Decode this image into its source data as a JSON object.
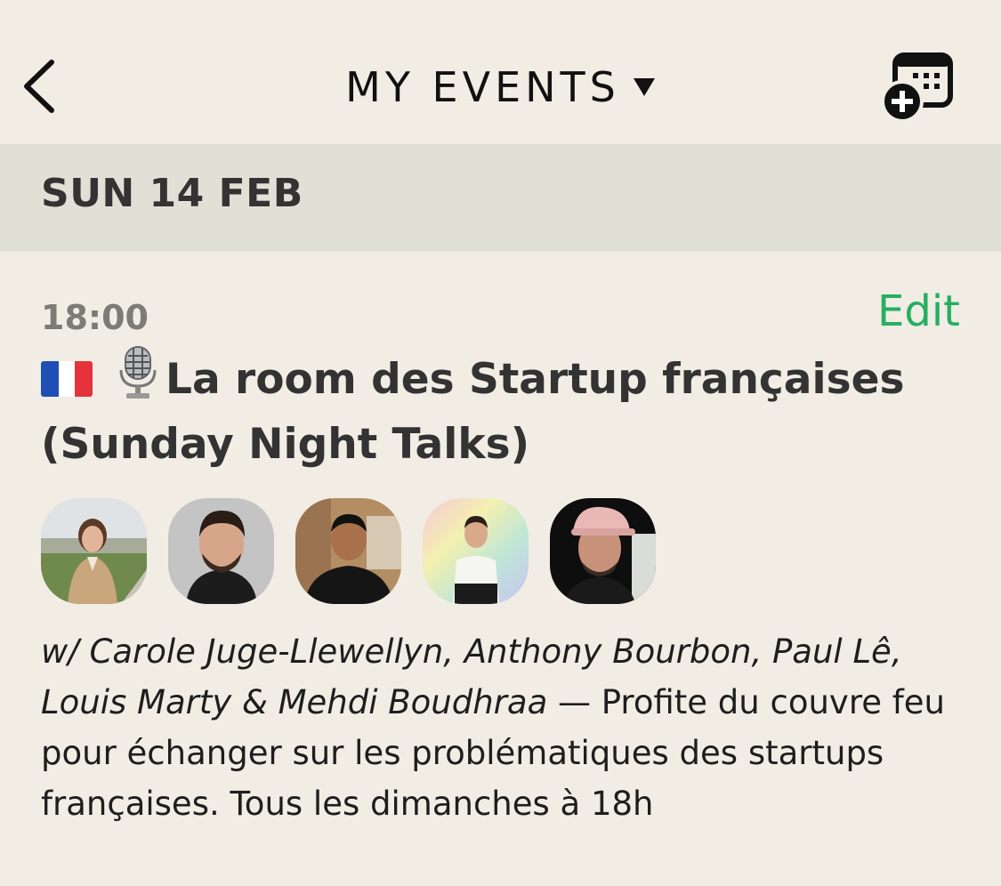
{
  "header": {
    "title": "MY EVENTS",
    "back_icon": "chevron-left-icon",
    "dropdown_icon": "caret-down-icon",
    "add_event_icon": "calendar-plus-icon"
  },
  "date_section": {
    "label": "SUN 14 FEB"
  },
  "event": {
    "time": "18:00",
    "edit_label": "Edit",
    "title_emojis": [
      "french-flag-icon",
      "microphone-icon"
    ],
    "title": "La room des Startup françaises (Sunday Night Talks)",
    "speakers": [
      "Carole Juge-Llewellyn",
      "Anthony Bourbon",
      "Paul Lê",
      "Louis Marty",
      "Mehdi Boudhraa"
    ],
    "speakers_text": "w/ Carole Juge-Llewellyn, Anthony Bourbon, Paul Lê, Louis Marty & Mehdi Boudhraa",
    "description": " — Profite du couvre feu pour échanger sur les problématiques des startups françaises. Tous les dimanches à 18h"
  },
  "colors": {
    "background": "#f1ede4",
    "date_bar": "#e1e0d6",
    "accent_green": "#27ae60",
    "time_grey": "#7d7b76",
    "title_text": "#333333"
  }
}
